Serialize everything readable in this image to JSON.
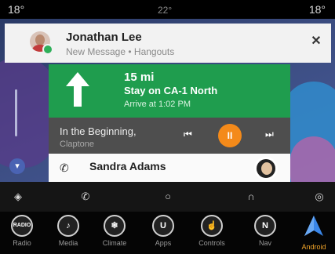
{
  "status": {
    "temp_left": "18°",
    "temp_mid": "22°",
    "temp_right": "18°"
  },
  "notification": {
    "sender": "Jonathan Lee",
    "subtitle": "New Message • Hangouts",
    "icons": {
      "avatar": "contact-avatar",
      "badge": "hangouts-icon",
      "close": "close-icon"
    },
    "close_glyph": "✕"
  },
  "navigation": {
    "distance": "15 mi",
    "instruction": "Stay on CA-1 North",
    "arrival": "Arrive at 1:02 PM",
    "icon": "straight-arrow-icon",
    "accent": "#1f9d4e"
  },
  "media": {
    "song": "In the Beginning,",
    "artist": "Claptone",
    "prev_glyph": "⏮",
    "play_glyph": "II",
    "next_glyph": "⏭",
    "accent": "#f48a1a"
  },
  "call": {
    "contact": "Sandra Adams",
    "icon": "phone-icon",
    "phone_glyph": "✆"
  },
  "android_auto_bar": {
    "items": [
      {
        "icon": "navigation-icon",
        "glyph": "◈"
      },
      {
        "icon": "phone-icon",
        "glyph": "✆"
      },
      {
        "icon": "home-icon",
        "glyph": "○"
      },
      {
        "icon": "headphones-icon",
        "glyph": "∩"
      },
      {
        "icon": "exit-icon",
        "glyph": "◎"
      }
    ]
  },
  "dock": {
    "items": [
      {
        "label": "Radio",
        "glyph": "RADIO",
        "icon": "radio-icon"
      },
      {
        "label": "Media",
        "glyph": "♪",
        "icon": "media-icon"
      },
      {
        "label": "Climate",
        "glyph": "❄",
        "icon": "climate-icon"
      },
      {
        "label": "Apps",
        "glyph": "U",
        "icon": "apps-icon"
      },
      {
        "label": "Controls",
        "glyph": "☝",
        "icon": "controls-icon"
      },
      {
        "label": "Nav",
        "glyph": "N",
        "icon": "nav-icon"
      },
      {
        "label": "Android",
        "glyph": "",
        "icon": "android-auto-icon"
      }
    ],
    "active_index": 6,
    "active_color": "#f2a52a"
  }
}
